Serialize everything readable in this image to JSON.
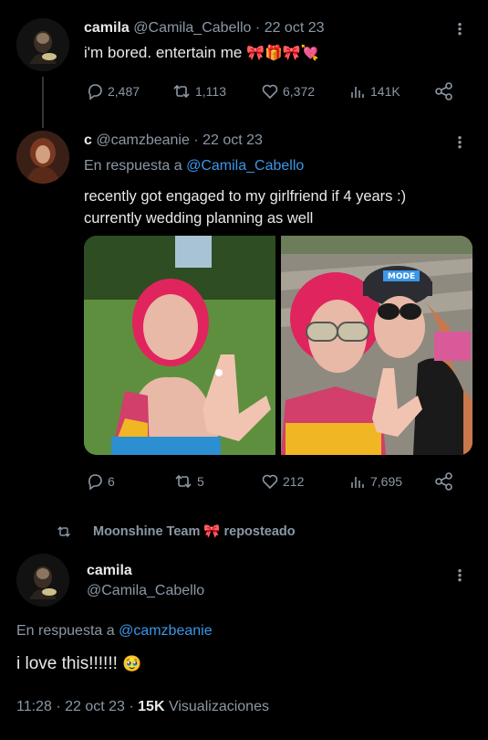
{
  "tweet1": {
    "name": "camila",
    "handle": "@Camila_Cabello",
    "sep": "·",
    "date": "22 oct 23",
    "text": "i'm bored. entertain me",
    "emojis": "🎀🎁🎀💘",
    "replies": "2,487",
    "retweets": "1,113",
    "likes": "6,372",
    "views": "141K"
  },
  "tweet2": {
    "name": "c",
    "handle": "@camzbeanie",
    "sep": "·",
    "date": "22 oct 23",
    "reply_prefix": "En respuesta a",
    "reply_to": "@Camila_Cabello",
    "text_line1": "recently got engaged to my girlfriend if 4 years :)",
    "text_line2": "currently wedding planning as well",
    "replies": "6",
    "retweets": "5",
    "likes": "212",
    "views": "7,695",
    "hat_text": "MODE"
  },
  "repost": {
    "label": "Moonshine Team",
    "emoji": "🎀",
    "suffix": "reposteado"
  },
  "tweet3": {
    "name": "camila",
    "handle": "@Camila_Cabello",
    "reply_prefix": "En respuesta a",
    "reply_to": "@camzbeanie",
    "text": "i love this!!!!!!",
    "emoji": "🥹",
    "time": "11:28",
    "sep": "·",
    "date": "22 oct 23",
    "sep2": "·",
    "views_count": "15K",
    "views_label": "Visualizaciones"
  },
  "colors": {
    "background": "#000000",
    "text": "#e7e9ea",
    "muted": "#8b98a5",
    "link": "#3b97e8"
  },
  "icons": [
    "reply-icon",
    "retweet-icon",
    "heart-icon",
    "views-icon",
    "share-icon",
    "more-icon"
  ]
}
